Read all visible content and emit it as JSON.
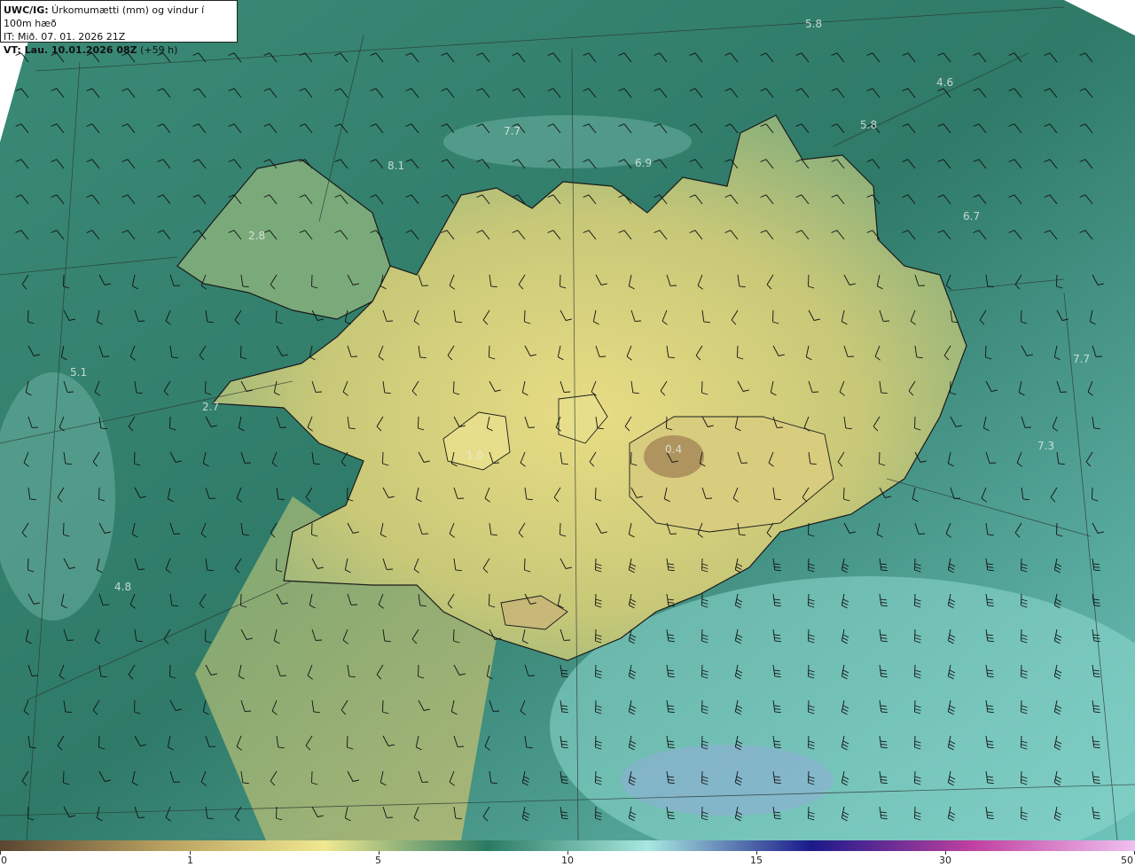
{
  "header": {
    "line1_bold": "UWC/IG:",
    "line1_rest": " Úrkomumætti (mm) og vindur í 100m hæð",
    "line2": "IT: Mið. 07. 01. 2026 21Z",
    "line3_bold": "VT: Lau. 10.01.2026 08Z",
    "line3_rest": " (+59 h)"
  },
  "map_values": [
    "5.8",
    "4.6",
    "5.8",
    "7.7",
    "8.1",
    "6.9",
    "6.7",
    "2.8",
    "5.1",
    "7.7",
    "2.7",
    "1.0",
    "0.4",
    "7.3",
    "4.8"
  ],
  "colorbar": {
    "labels": [
      "0",
      "1",
      "5",
      "10",
      "15",
      "30",
      "50"
    ],
    "colors": [
      "#5a4632",
      "#b8a060",
      "#f0e890",
      "#2a7a62",
      "#a8e8e0",
      "#1a1a8a",
      "#c040a0",
      "#f0c0f0"
    ]
  }
}
